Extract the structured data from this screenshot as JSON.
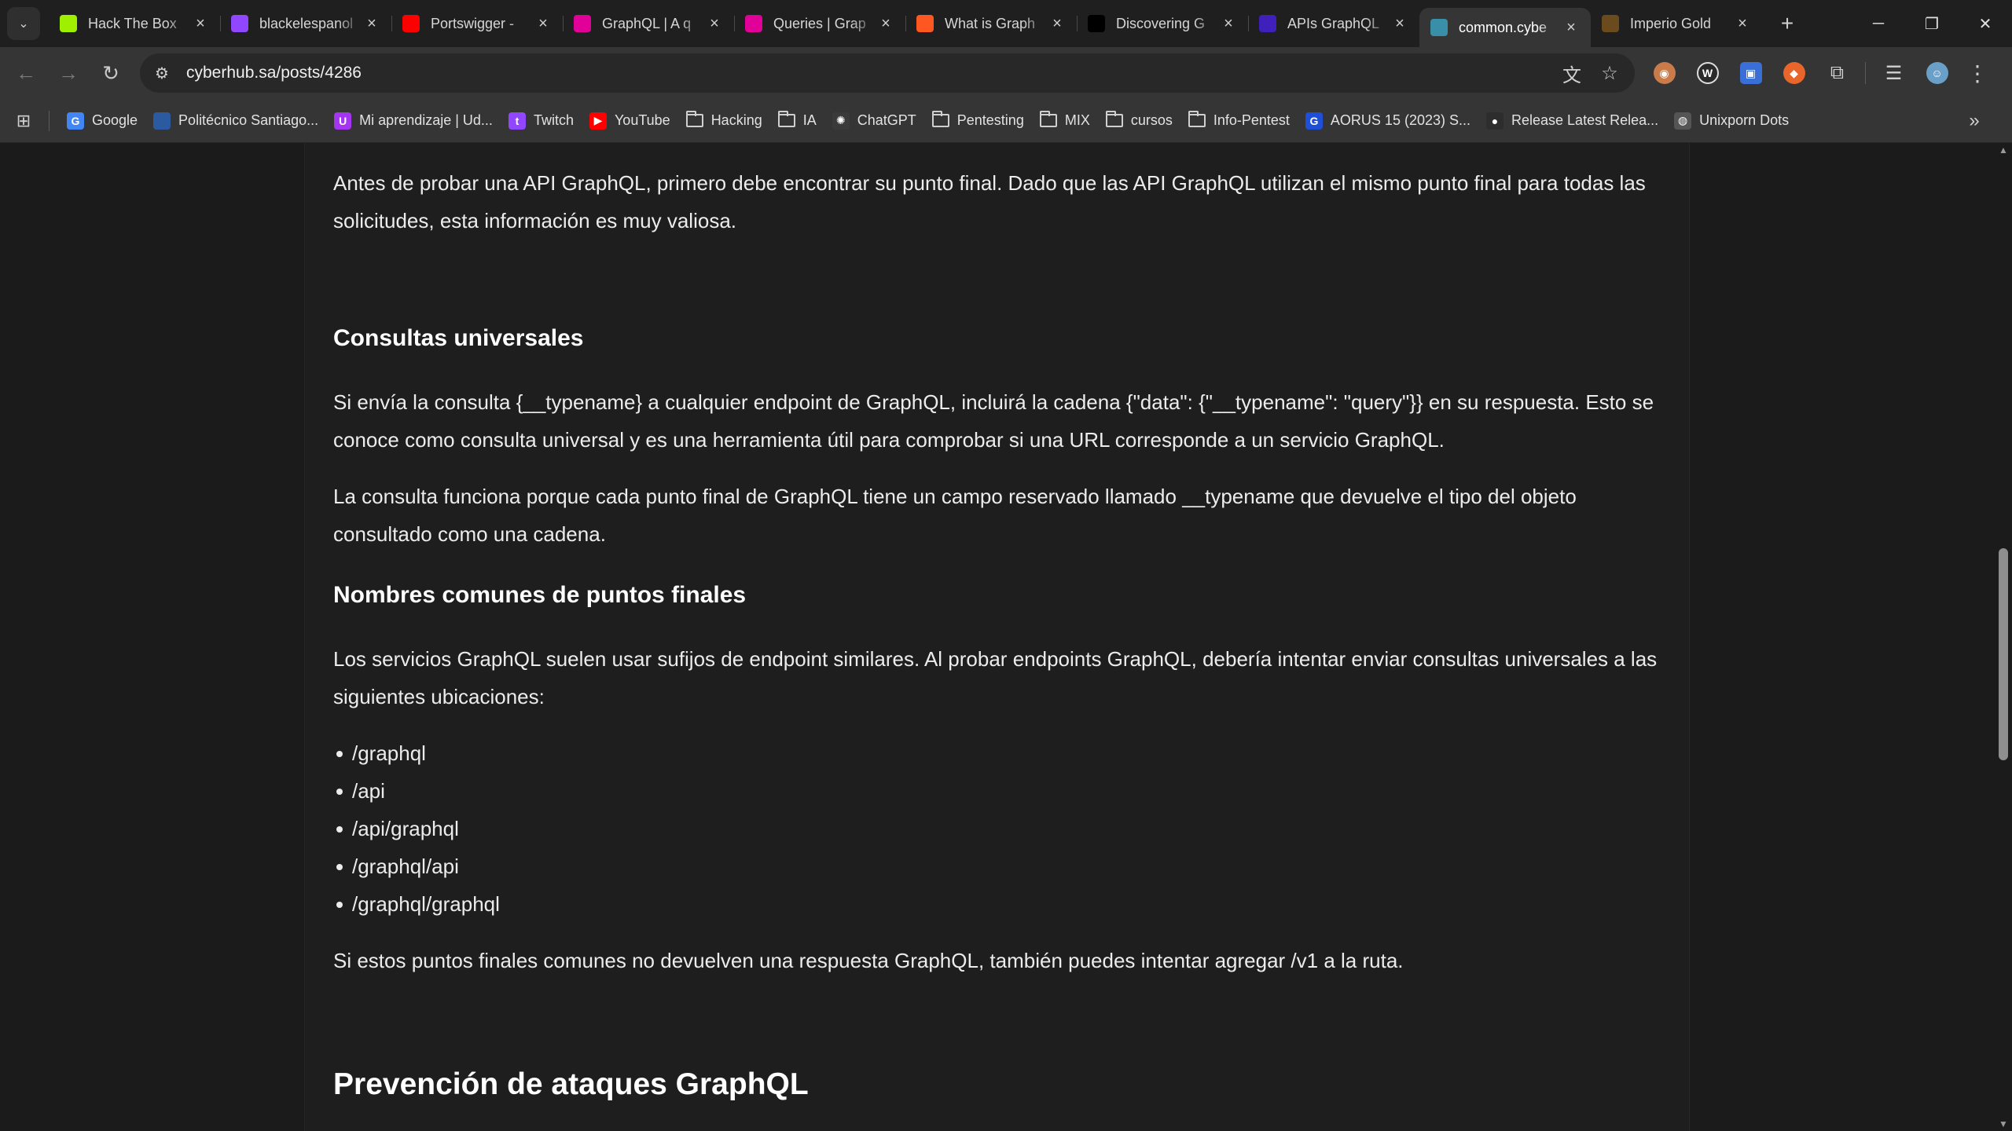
{
  "tabs": [
    {
      "title": "Hack The Box",
      "icon": "hackthebox-icon",
      "color": "#9fef00"
    },
    {
      "title": "blackelespanol",
      "icon": "twitch-icon",
      "color": "#9146ff"
    },
    {
      "title": "Portswigger - ",
      "icon": "youtube-icon",
      "color": "#ff0000"
    },
    {
      "title": "GraphQL | A q",
      "icon": "graphql-icon",
      "color": "#e10098"
    },
    {
      "title": "Queries | Grap",
      "icon": "graphql-icon",
      "color": "#e10098"
    },
    {
      "title": "What is Graph",
      "icon": "hackerone-icon",
      "color": "#ff5722"
    },
    {
      "title": "Discovering G",
      "icon": "medium-icon",
      "color": "#000000"
    },
    {
      "title": "APIs GraphQL",
      "icon": "apollo-icon",
      "color": "#3f20ba"
    },
    {
      "title": "common.cybe",
      "icon": "cyberhub-icon",
      "color": "#3a8fa8",
      "active": true
    },
    {
      "title": "Imperio Gold",
      "icon": "imperio-icon",
      "color": "#6b4a1e"
    }
  ],
  "toolbar": {
    "url": "cyberhub.sa/posts/4286"
  },
  "bookmarks": [
    {
      "label": "Google",
      "type": "site",
      "icon": "google-icon",
      "glyph": "G",
      "color": "#4285f4"
    },
    {
      "label": "Politécnico Santiago...",
      "type": "site",
      "icon": "politecnico-icon",
      "glyph": "",
      "color": "#2c5aa0"
    },
    {
      "label": "Mi aprendizaje | Ud...",
      "type": "site",
      "icon": "udemy-icon",
      "glyph": "U",
      "color": "#a435f0"
    },
    {
      "label": "Twitch",
      "type": "site",
      "icon": "twitch-icon",
      "glyph": "t",
      "color": "#9146ff"
    },
    {
      "label": "YouTube",
      "type": "site",
      "icon": "youtube-icon",
      "glyph": "▶",
      "color": "#ff0000"
    },
    {
      "label": "Hacking",
      "type": "folder"
    },
    {
      "label": "IA",
      "type": "folder"
    },
    {
      "label": "ChatGPT",
      "type": "site",
      "icon": "chatgpt-icon",
      "glyph": "✺",
      "color": "#3a3a3a"
    },
    {
      "label": "Pentesting",
      "type": "folder"
    },
    {
      "label": "MIX",
      "type": "folder"
    },
    {
      "label": "cursos",
      "type": "folder"
    },
    {
      "label": "Info-Pentest",
      "type": "folder"
    },
    {
      "label": "AORUS 15 (2023) S...",
      "type": "site",
      "icon": "gigabyte-icon",
      "glyph": "G",
      "color": "#1e4fd6"
    },
    {
      "label": "Release Latest Relea...",
      "type": "site",
      "icon": "github-icon",
      "glyph": "●",
      "color": "#2d2d2d"
    },
    {
      "label": "Unixporn Dots",
      "type": "site",
      "icon": "globe-icon",
      "glyph": "◍",
      "color": "#555555"
    }
  ],
  "article": {
    "intro": "Antes de probar una API GraphQL, primero debe encontrar su punto final. Dado que las API GraphQL utilizan el mismo punto final para todas las solicitudes, esta información es muy valiosa.",
    "h_universal": "Consultas universales",
    "p_universal_1": "Si envía  la consulta {__typename}  a cualquier endpoint de GraphQL, incluirá la cadena  {\"data\": {\"__typename\": \"query\"}}  en su respuesta. Esto se conoce como consulta universal y es una herramienta útil para comprobar si una URL corresponde a un servicio GraphQL.",
    "p_universal_2": "La consulta funciona porque cada punto final de GraphQL tiene un campo reservado llamado  __typename  que devuelve el tipo del objeto consultado como una cadena.",
    "h_common": "Nombres comunes de puntos finales",
    "p_common": "Los servicios GraphQL suelen usar sufijos de endpoint similares. Al probar endpoints GraphQL, debería intentar enviar consultas universales a las siguientes ubicaciones:",
    "paths": [
      "/graphql",
      "/api",
      "/api/graphql",
      "/graphql/api",
      "/graphql/graphql"
    ],
    "p_v1": "Si estos puntos finales comunes no devuelven una respuesta GraphQL, también puedes intentar agregar  /v1  a la ruta.",
    "h_prevention": "Prevención de ataques GraphQL"
  }
}
